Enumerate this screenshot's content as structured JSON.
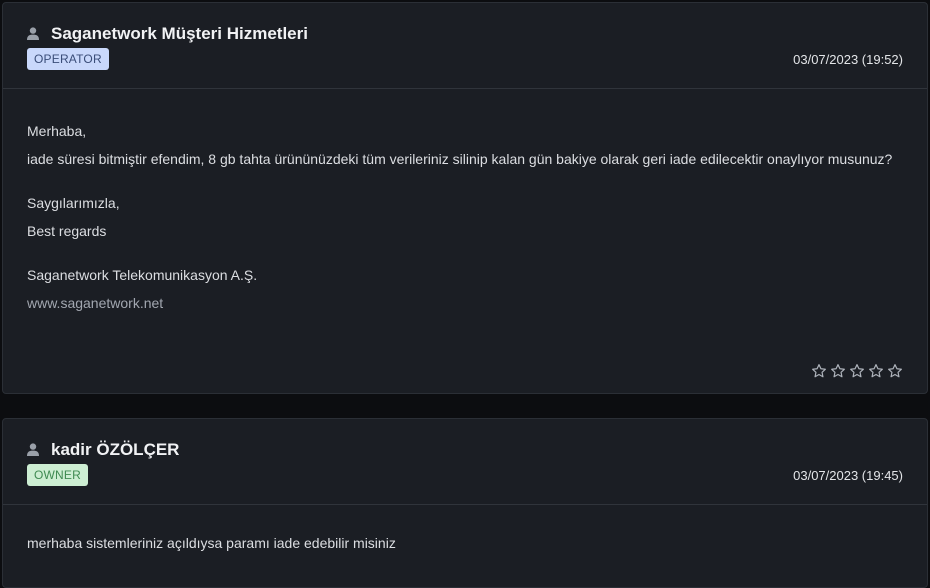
{
  "messages": [
    {
      "author": "Saganetwork Müşteri Hizmetleri",
      "badge": "OPERATOR",
      "date": "03/07/2023 (19:52)",
      "paragraphs": [
        [
          "Merhaba,",
          "iade süresi bitmiştir efendim, 8 gb tahta ürününüzdeki tüm verileriniz silinip kalan gün bakiye olarak geri iade edilecektir onaylıyor musunuz?"
        ],
        [
          "Saygılarımızla,",
          "Best regards"
        ]
      ],
      "company": "Saganetwork Telekomunikasyon A.Ş.",
      "website": "www.saganetwork.net",
      "rating": 0,
      "rating_max": 5
    },
    {
      "author": "kadir ÖZÖLÇER",
      "badge": "OWNER",
      "date": "03/07/2023 (19:45)",
      "text": "merhaba sistemleriniz açıldıysa paramı iade edebilir misiniz"
    }
  ],
  "icons": {
    "user": "user-icon",
    "star": "star-outline-icon"
  },
  "colors": {
    "operator_badge": "#c9d8fb",
    "owner_badge": "#cdeed3",
    "background": "#0c0d10",
    "card": "#1b1e24"
  }
}
